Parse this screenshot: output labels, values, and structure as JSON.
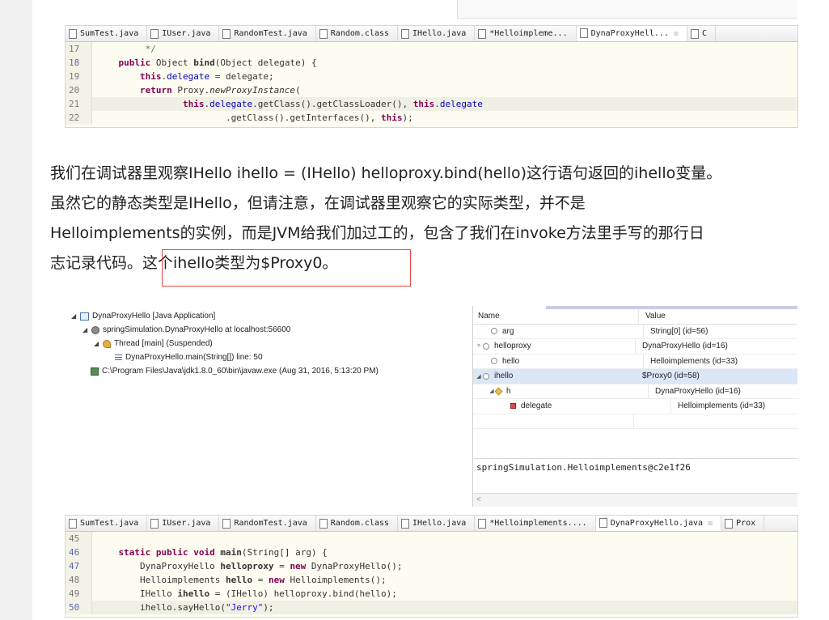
{
  "top_editor": {
    "tabs": [
      "SumTest.java",
      "IUser.java",
      "RandomTest.java",
      "Random.class",
      "IHello.java",
      "*Helloimpleme...",
      "DynaProxyHell...",
      "C"
    ],
    "active_tab_close": "☒",
    "lines": [
      {
        "n": "17",
        "t": "         */"
      },
      {
        "n": "18",
        "t": "    public Object bind(Object delegate) {"
      },
      {
        "n": "19",
        "t": "        this.delegate = delegate;"
      },
      {
        "n": "20",
        "t": "        return Proxy.newProxyInstance("
      },
      {
        "n": "21",
        "t": "                this.delegate.getClass().getClassLoader(), this.delegate"
      },
      {
        "n": "22",
        "t": "                        .getClass().getInterfaces(), this);"
      }
    ]
  },
  "article": {
    "line1": "我们在调试器里观察IHello ihello = (IHello) helloproxy.bind(hello)这行语句返回的ihello变量。",
    "line2": "虽然它的静态类型是IHello，但请注意，在调试器里观察它的实际类型，并不是",
    "line3": "Helloimplements的实例，而是JVM给我们加过工的，包含了我们在invoke方法里手写的那行日",
    "line4_a": "志记录代码。",
    "line4_b": "这个ihello类型为$Proxy0。"
  },
  "debug_tree": [
    {
      "label": "DynaProxyHello [Java Application]"
    },
    {
      "label": "springSimulation.DynaProxyHello at localhost:56600"
    },
    {
      "label": "Thread [main] (Suspended)"
    },
    {
      "label": "DynaProxyHello.main(String[]) line: 50"
    },
    {
      "label": "C:\\Program Files\\Java\\jdk1.8.0_60\\bin\\javaw.exe (Aug 31, 2016, 5:13:20 PM)"
    }
  ],
  "variables": {
    "col_name": "Name",
    "col_value": "Value",
    "rows": [
      {
        "name": "arg",
        "value": "String[0]  (id=56)"
      },
      {
        "name": "helloproxy",
        "value": "DynaProxyHello  (id=16)"
      },
      {
        "name": "hello",
        "value": "Helloimplements  (id=33)"
      },
      {
        "name": "ihello",
        "value": "$Proxy0  (id=58)"
      },
      {
        "name": "h",
        "value": "DynaProxyHello  (id=16)"
      },
      {
        "name": "delegate",
        "value": "Helloimplements  (id=33)"
      }
    ],
    "detail": "springSimulation.Helloimplements@c2e1f26",
    "scroll_left": "<"
  },
  "bottom_editor": {
    "tabs": [
      "SumTest.java",
      "IUser.java",
      "RandomTest.java",
      "Random.class",
      "IHello.java",
      "*Helloimplements....",
      "DynaProxyHello.java",
      "Prox"
    ],
    "active_tab_close": "☒",
    "lines": [
      {
        "n": "45",
        "t": ""
      },
      {
        "n": "46",
        "t": "    static public void main(String[] arg) {"
      },
      {
        "n": "47",
        "t": "        DynaProxyHello helloproxy = new DynaProxyHello();"
      },
      {
        "n": "48",
        "t": "        Helloimplements hello = new Helloimplements();"
      },
      {
        "n": "49",
        "t": "        IHello ihello = (IHello) helloproxy.bind(hello);"
      },
      {
        "n": "50",
        "t": "        ihello.sayHello(\"Jerry\");"
      }
    ]
  }
}
